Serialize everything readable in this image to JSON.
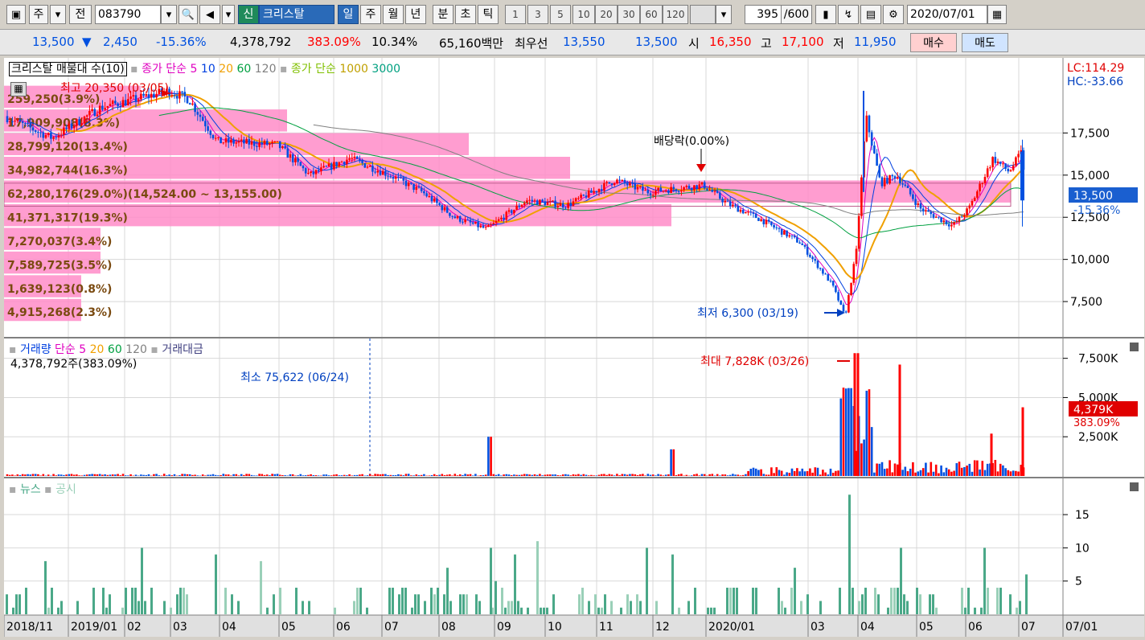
{
  "toolbar": {
    "market": "주",
    "prev": "전",
    "code": "083790",
    "badge": "신",
    "name": "크리스탈",
    "periods": [
      "일",
      "주",
      "월",
      "년",
      "분",
      "초",
      "틱"
    ],
    "minutes": [
      "1",
      "3",
      "5",
      "10",
      "20",
      "30",
      "60",
      "120"
    ],
    "count": "395",
    "count_total": "/600",
    "date": "2020/07/01"
  },
  "quote": {
    "price": "13,500",
    "change": "2,450",
    "change_pct": "-15.36%",
    "volume": "4,378,792",
    "vol_ratio": "383.09%",
    "turnover": "10.34%",
    "amount": "65,160백만",
    "best_label": "최우선",
    "ask": "13,550",
    "bid": "13,500",
    "open_label": "시",
    "open": "16,350",
    "high_label": "고",
    "high": "17,100",
    "low_label": "저",
    "low": "11,950",
    "buy": "매수",
    "sell": "매도"
  },
  "legend": {
    "main": "크리스탈 매물대 수(10)",
    "ma_label": "종가 단순",
    "ma_periods": [
      "5",
      "10",
      "20",
      "60",
      "120"
    ],
    "ma_long_label": "종가 단순",
    "ma_long_periods": [
      "1000",
      "3000"
    ],
    "lc": "LC:114.29",
    "hc": "HC:-33.66",
    "vol_label": "거래량",
    "vol_ma_label": "단순",
    "vol_ma_periods": [
      "5",
      "20",
      "60",
      "120"
    ],
    "amount_label": "거래대금",
    "vol_now": "4,378,792주(383.09%)",
    "news": "뉴스",
    "disclosure": "공시"
  },
  "annotations": {
    "max": "최고 20,350 (03/05)",
    "min": "최저 6,300 (03/19)",
    "div1": "배당락(0.00%)",
    "div2": "배당락(0.00%)",
    "vol_max": "최대 7,828K (03/26)",
    "vol_min": "최소 75,622 (06/24)",
    "price_tag": "13,500",
    "price_pct": "-15.36%",
    "vol_tag": "4,379K",
    "vol_pct": "383.09%"
  },
  "volume_profile": [
    "259,250(3.9%)",
    "17,909,908(8.3%)",
    "28,799,120(13.4%)",
    "34,982,744(16.3%)",
    "62,280,176(29.0%)(14,524.00 ~ 13,155.00)",
    "41,371,317(19.3%)",
    "7,270,037(3.4%)",
    "7,589,725(3.5%)",
    "1,639,123(0.8%)",
    "4,915,268(2.3%)"
  ],
  "price_axis": [
    "17,500",
    "15,000",
    "12,500",
    "10,000",
    "7,500"
  ],
  "vol_axis": [
    "7,500K",
    "5,000K",
    "2,500K"
  ],
  "news_axis": [
    "15",
    "10",
    "5"
  ],
  "x_axis": [
    "2018/11",
    "2019/01",
    "02",
    "03",
    "04",
    "05",
    "06",
    "07",
    "08",
    "09",
    "10",
    "11",
    "12",
    "2020/01",
    "03",
    "04",
    "05",
    "06",
    "07",
    "07/01"
  ],
  "colors": {
    "up": "#ff0000",
    "down": "#0050e0",
    "profile": "#ff8cc8",
    "news": "#4aa888",
    "ma5": "#e000c0",
    "ma10": "#0040e0",
    "ma20": "#f0a000",
    "ma60": "#00a040",
    "ma120": "#808080"
  },
  "chart_data": {
    "type": "candlestick",
    "price_min": 6300,
    "price_max": 20350,
    "last_close": 13500,
    "volume_max_k": 7828,
    "volume_last_k": 4379
  }
}
